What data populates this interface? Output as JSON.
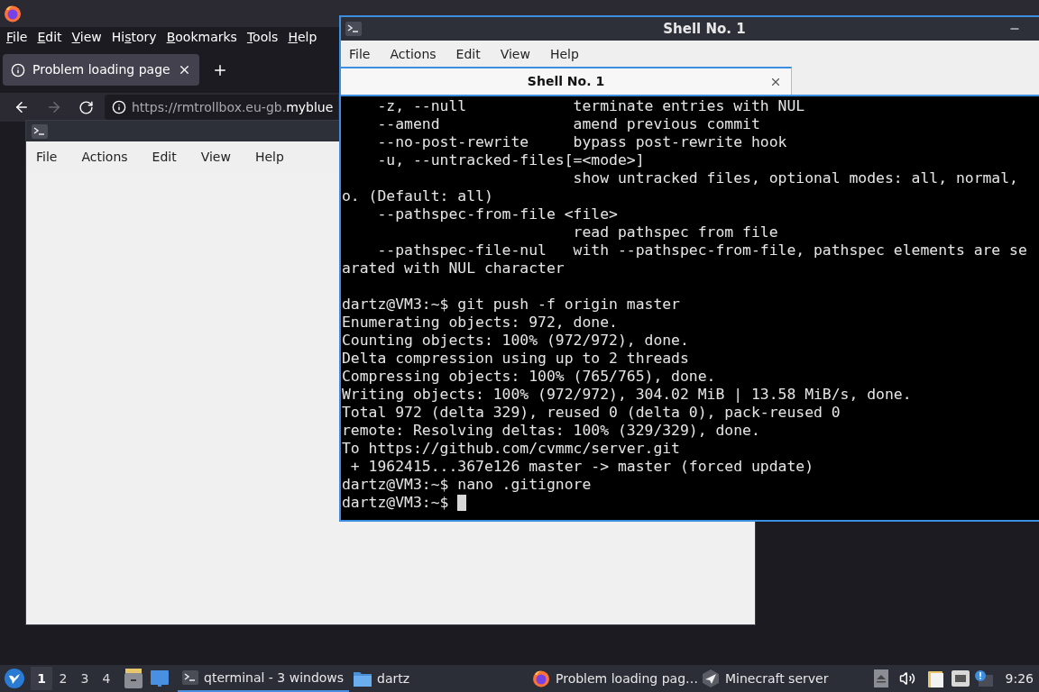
{
  "firefox": {
    "menu": [
      {
        "key": "F",
        "after": "ile"
      },
      {
        "key": "E",
        "after": "dit"
      },
      {
        "key": "V",
        "after": "iew"
      },
      {
        "before": "Hi",
        "key": "s",
        "after": "tory"
      },
      {
        "key": "B",
        "after": "ookmarks"
      },
      {
        "key": "T",
        "after": "ools"
      },
      {
        "key": "H",
        "after": "elp"
      }
    ],
    "tabs": [
      {
        "label": "Problem loading page",
        "selected": true
      }
    ],
    "forward_disabled": true,
    "url": {
      "prefix": "https://rmtrollbox.eu-gb.",
      "host": "myblue"
    }
  },
  "back_terminal": {
    "menu": [
      "File",
      "Actions",
      "Edit",
      "View",
      "Help"
    ]
  },
  "shell": {
    "title": "Shell No. 1",
    "menu": [
      "File",
      "Actions",
      "Edit",
      "View",
      "Help"
    ],
    "tabs": [
      {
        "label": "Shell No. 1",
        "selected": true
      }
    ],
    "lines": [
      {
        "kind": "text",
        "text": "    -z, --null            terminate entries with NUL"
      },
      {
        "kind": "text",
        "text": "    --amend               amend previous commit"
      },
      {
        "kind": "text",
        "text": "    --no-post-rewrite     bypass post-rewrite hook"
      },
      {
        "kind": "text",
        "text": "    -u, --untracked-files[=<mode>]"
      },
      {
        "kind": "text",
        "text": "                          show untracked files, optional modes: all, normal,"
      },
      {
        "kind": "text",
        "text": "o. (Default: all)"
      },
      {
        "kind": "text",
        "text": "    --pathspec-from-file <file>"
      },
      {
        "kind": "text",
        "text": "                          read pathspec from file"
      },
      {
        "kind": "text",
        "text": "    --pathspec-file-nul   with --pathspec-from-file, pathspec elements are se"
      },
      {
        "kind": "text",
        "text": "arated with NUL character"
      },
      {
        "kind": "blank"
      },
      {
        "kind": "text",
        "text": "dartz@VM3:~$ git push -f origin master"
      },
      {
        "kind": "text",
        "text": "Enumerating objects: 972, done."
      },
      {
        "kind": "text",
        "text": "Counting objects: 100% (972/972), done."
      },
      {
        "kind": "text",
        "text": "Delta compression using up to 2 threads"
      },
      {
        "kind": "text",
        "text": "Compressing objects: 100% (765/765), done."
      },
      {
        "kind": "text",
        "text": "Writing objects: 100% (972/972), 304.02 MiB | 13.58 MiB/s, done."
      },
      {
        "kind": "text",
        "text": "Total 972 (delta 329), reused 0 (delta 0), pack-reused 0"
      },
      {
        "kind": "text",
        "text": "remote: Resolving deltas: 100% (329/329), done."
      },
      {
        "kind": "text",
        "text": "To https://github.com/cvmmc/server.git"
      },
      {
        "kind": "text",
        "text": " + 1962415...367e126 master -> master (forced update)"
      },
      {
        "kind": "text",
        "text": "dartz@VM3:~$ nano .gitignore"
      },
      {
        "kind": "prompt",
        "text": "dartz@VM3:~$",
        "cursor": true
      }
    ]
  },
  "taskbar": {
    "desktops": [
      {
        "label": "1",
        "selected": true
      },
      {
        "label": "2",
        "selected": false
      },
      {
        "label": "3",
        "selected": false
      },
      {
        "label": "4",
        "selected": false
      }
    ],
    "tasks": [
      {
        "kind": "terminal",
        "label": "qterminal - 3 windows",
        "selected": true
      },
      {
        "kind": "folder",
        "label": "dartz",
        "selected": false
      },
      {
        "kind": "browser",
        "label": "Problem loading pag…",
        "selected": false
      },
      {
        "kind": "app",
        "label": "Minecraft server",
        "selected": false
      }
    ],
    "clock": "9:26"
  }
}
